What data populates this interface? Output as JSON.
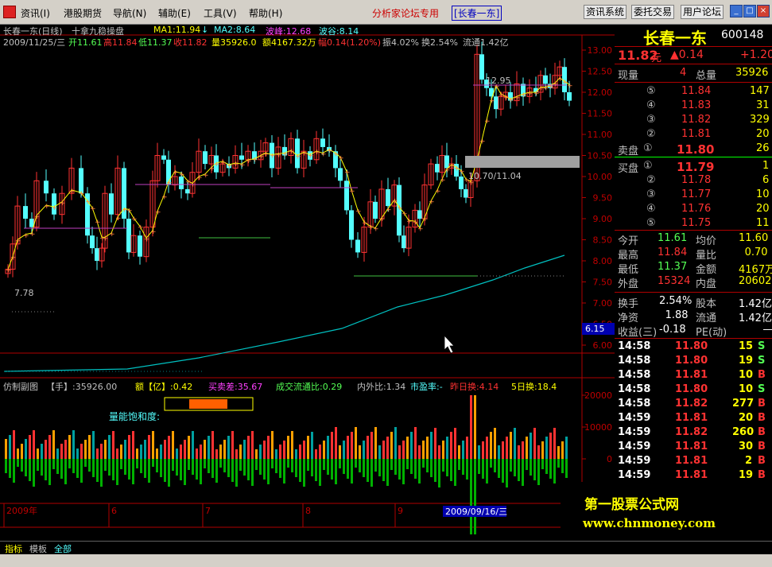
{
  "menu": {
    "items": [
      "资讯(I)",
      "港股期货",
      "导航(N)",
      "辅助(E)",
      "工具(V)",
      "帮助(H)"
    ],
    "forum_title": "分析家论坛专用",
    "forum_stock": "[长春一东]",
    "buttons": [
      "资讯系统",
      "委托交易",
      "用户论坛"
    ]
  },
  "chart_header": {
    "name": "长春一东(日线)",
    "indicator": "十拿九稳操盘",
    "ma1": "MA1:11.94",
    "ma1_arrow": "↓",
    "ma2": "MA2:8.64",
    "peak": "波峰:12.68",
    "valley": "波谷:8.14",
    "date": "2009/11/25/三",
    "open": "开11.61",
    "high": "高11.84",
    "low": "低11.37",
    "close": "收11.82",
    "vol": "量35926.0",
    "amount": "额4167.32万",
    "change": "幅0.14(1.20%)",
    "amp": "振4.02%",
    "turn": "换2.54%",
    "float": "流通1.42亿"
  },
  "price_axis": [
    "13.00",
    "12.50",
    "12.00",
    "11.50",
    "11.00",
    "10.50",
    "10.00",
    "9.50",
    "9.00",
    "8.50",
    "8.00",
    "7.50",
    "7.00",
    "6.50",
    "6.00"
  ],
  "price_box_label": "6.15",
  "annotations": {
    "high_label": "12.95",
    "low_label": "7.78",
    "zone_label": "10.70/11.04"
  },
  "sub_header": {
    "title": "仿制副图",
    "hand": "【手】:35926.00",
    "amount": "额【亿】:0.42",
    "buy_sell": "买卖差:35.67",
    "ratio": "成交流通比:0.29",
    "inout": "内外比:1.34",
    "pe": "市盈率:-",
    "yest": "昨日换:4.14",
    "five": "5日换:18.4",
    "energy": "量能饱和度:"
  },
  "vol_axis": [
    "20000",
    "10000",
    "0"
  ],
  "date_axis": {
    "labels": [
      "2009年",
      "6",
      "7",
      "8",
      "9"
    ],
    "cursor": "2009/09/16/三"
  },
  "tabs": [
    "指标",
    "模板",
    "全部"
  ],
  "panel": {
    "stock_name": "长春一东",
    "code": "600148",
    "price": "11.82",
    "unit": "元",
    "change": "▲0.14",
    "change_pct": "+1.20",
    "xianliang_label": "现量",
    "xianliang": "4",
    "zongliang_label": "总量",
    "zongliang": "35926",
    "sell_orders": [
      {
        "level": "⑤",
        "price": "11.84",
        "vol": "147"
      },
      {
        "level": "④",
        "price": "11.83",
        "vol": "31"
      },
      {
        "level": "③",
        "price": "11.82",
        "vol": "329"
      },
      {
        "level": "②",
        "price": "11.81",
        "vol": "20"
      },
      {
        "level": "①",
        "price": "11.80",
        "vol": "26"
      }
    ],
    "sell_label": "卖盘",
    "buy_label": "买盘",
    "buy_orders": [
      {
        "level": "①",
        "price": "11.79",
        "vol": "1"
      },
      {
        "level": "②",
        "price": "11.78",
        "vol": "6"
      },
      {
        "level": "③",
        "price": "11.77",
        "vol": "10"
      },
      {
        "level": "④",
        "price": "11.76",
        "vol": "20"
      },
      {
        "level": "⑤",
        "price": "11.75",
        "vol": "11"
      }
    ],
    "stats": [
      {
        "l1": "今开",
        "v1": "11.61",
        "l2": "均价",
        "v2": "11.60"
      },
      {
        "l1": "最高",
        "v1": "11.84",
        "l2": "量比",
        "v2": "0.70"
      },
      {
        "l1": "最低",
        "v1": "11.37",
        "l2": "金额",
        "v2": "4167万"
      },
      {
        "l1": "外盘",
        "v1": "15324",
        "l2": "内盘",
        "v2": "20602"
      }
    ],
    "stats2": [
      {
        "l1": "换手",
        "v1": "2.54%",
        "l2": "股本",
        "v2": "1.42亿"
      },
      {
        "l1": "净资",
        "v1": "1.88",
        "l2": "流通",
        "v2": "1.42亿"
      },
      {
        "l1": "收益(三)",
        "v1": "-0.18",
        "l2": "PE(动)",
        "v2": "—"
      }
    ],
    "ticks": [
      {
        "t": "14:58",
        "p": "11.80",
        "v": "15",
        "d": "S"
      },
      {
        "t": "14:58",
        "p": "11.80",
        "v": "19",
        "d": "S"
      },
      {
        "t": "14:58",
        "p": "11.81",
        "v": "10",
        "d": "B"
      },
      {
        "t": "14:58",
        "p": "11.80",
        "v": "10",
        "d": "S"
      },
      {
        "t": "14:58",
        "p": "11.82",
        "v": "277",
        "d": "B"
      },
      {
        "t": "14:59",
        "p": "11.81",
        "v": "20",
        "d": "B"
      },
      {
        "t": "14:59",
        "p": "11.82",
        "v": "260",
        "d": "B"
      },
      {
        "t": "14:59",
        "p": "11.81",
        "v": "30",
        "d": "B"
      },
      {
        "t": "14:59",
        "p": "11.81",
        "v": "2",
        "d": "B"
      },
      {
        "t": "14:59",
        "p": "11.81",
        "v": "19",
        "d": "B"
      }
    ]
  },
  "brand": {
    "name": "第一股票公式网",
    "url": "www.chnmoney.com"
  },
  "colors": {
    "up": "#ff3232",
    "down": "#54ffff",
    "ma": "#ffff00",
    "cyan": "#00c0c0"
  }
}
